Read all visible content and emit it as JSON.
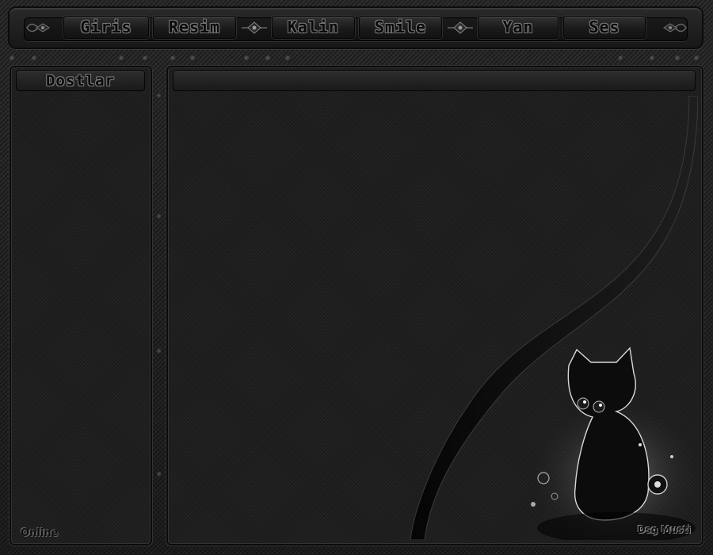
{
  "nav": {
    "items": [
      {
        "label": "Giris"
      },
      {
        "label": "Resim"
      },
      {
        "label": "Kalin"
      },
      {
        "label": "Smile"
      },
      {
        "label": "Yan"
      },
      {
        "label": "Ses"
      }
    ]
  },
  "sidebar": {
    "title": "Dostlar"
  },
  "footer": {
    "status": "Online",
    "credit": "Dsg Musti"
  },
  "colors": {
    "background": "#1a1a1a",
    "text_emboss": "#777777"
  },
  "icons": [
    "left-ornament-icon",
    "diamond-ornament-icon",
    "right-ornament-icon",
    "cat-illustration"
  ]
}
